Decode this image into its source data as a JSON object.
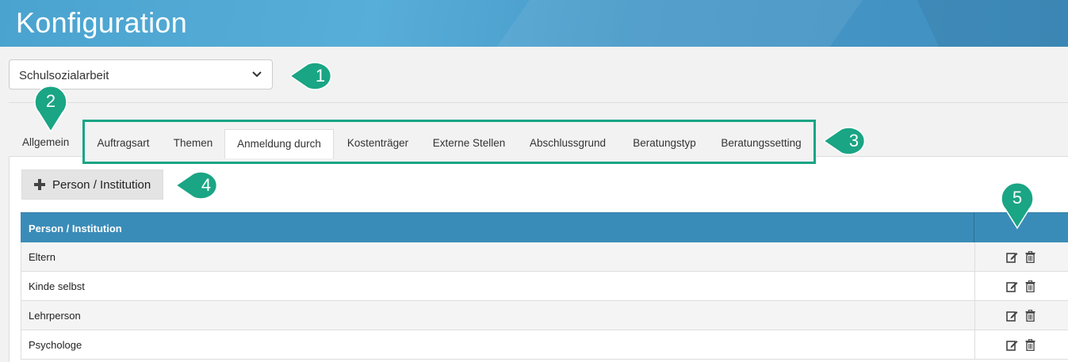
{
  "header": {
    "title": "Konfiguration"
  },
  "dropdown": {
    "selected": "Schulsozialarbeit"
  },
  "tabs": {
    "allgemein": "Allgemein",
    "items": [
      {
        "label": "Auftragsart",
        "active": false
      },
      {
        "label": "Themen",
        "active": false
      },
      {
        "label": "Anmeldung durch",
        "active": true
      },
      {
        "label": "Kostenträger",
        "active": false
      },
      {
        "label": "Externe Stellen",
        "active": false
      },
      {
        "label": "Abschlussgrund",
        "active": false
      },
      {
        "label": "Beratungstyp",
        "active": false
      },
      {
        "label": "Beratungssetting",
        "active": false
      }
    ]
  },
  "add_button": {
    "label": "Person / Institution",
    "icon": "plus-icon"
  },
  "table": {
    "header": "Person / Institution",
    "rows": [
      "Eltern",
      "Kinde selbst",
      "Lehrperson",
      "Psychologe"
    ],
    "actions": [
      "edit-icon",
      "trash-icon"
    ]
  },
  "callouts": [
    "1",
    "2",
    "3",
    "4",
    "5"
  ],
  "colors": {
    "accent": "#1aa584",
    "header_blue": "#3a8cb8",
    "banner": "#4aa3cf"
  }
}
